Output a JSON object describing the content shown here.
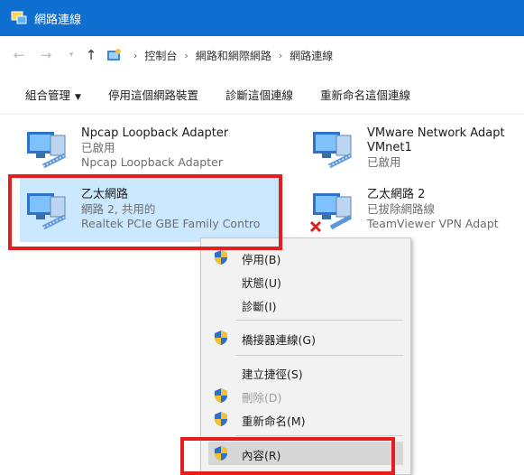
{
  "window": {
    "title": "網路連線"
  },
  "address": {
    "back_icon": "←",
    "forward_icon": "→",
    "up_icon": "↑",
    "segments": [
      "控制台",
      "網路和網際網路",
      "網路連線"
    ]
  },
  "toolbar": {
    "organize": "組合管理",
    "disable": "停用這個網路裝置",
    "diagnose": "診斷這個連線",
    "rename": "重新命名這個連線"
  },
  "connections": [
    {
      "name": "Npcap Loopback Adapter",
      "status": "已啟用",
      "device": "Npcap Loopback Adapter"
    },
    {
      "name": "VMware Network Adapt",
      "name2": "VMnet1",
      "status": "已啟用"
    },
    {
      "name": "乙太網路",
      "status": "網路 2, 共用的",
      "device": "Realtek PCIe GBE Family Contro"
    },
    {
      "name": "乙太網路 2",
      "status": "已拔除網路線",
      "device": "TeamViewer VPN Adapt"
    }
  ],
  "context_menu": {
    "items": [
      {
        "label": "停用(B)"
      },
      {
        "label": "狀態(U)"
      },
      {
        "label": "診斷(I)"
      },
      {
        "label": "橋接器連線(G)"
      },
      {
        "label": "建立捷徑(S)"
      },
      {
        "label": "刪除(D)"
      },
      {
        "label": "重新命名(M)"
      },
      {
        "label": "內容(R)"
      }
    ]
  },
  "colors": {
    "titlebar": "#0f6fd0",
    "highlight": "#e41e1e",
    "selection": "#cce8ff"
  }
}
